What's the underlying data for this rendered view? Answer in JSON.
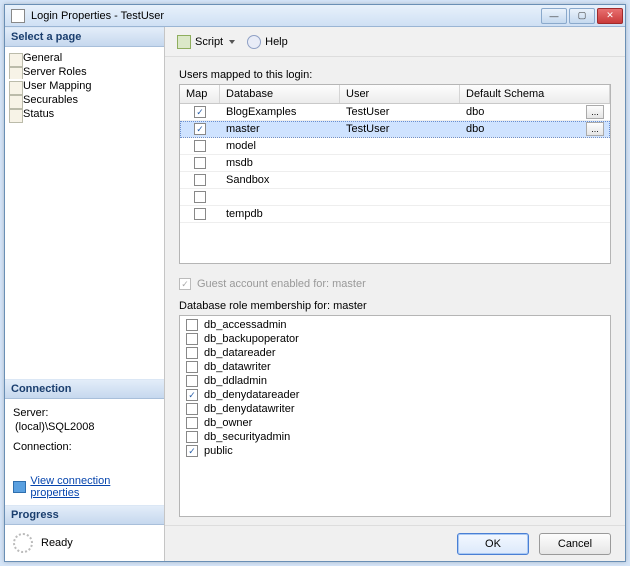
{
  "window": {
    "title": "Login Properties - TestUser"
  },
  "sidebar": {
    "select_page": "Select a page",
    "pages": [
      {
        "label": "General"
      },
      {
        "label": "Server Roles"
      },
      {
        "label": "User Mapping"
      },
      {
        "label": "Securables"
      },
      {
        "label": "Status"
      }
    ],
    "connection_head": "Connection",
    "server_label": "Server:",
    "server_value": "(local)\\SQL2008",
    "connection_label": "Connection:",
    "view_props": "View connection properties",
    "progress_head": "Progress",
    "progress_status": "Ready"
  },
  "toolbar": {
    "script": "Script",
    "help": "Help"
  },
  "main": {
    "users_mapped_label": "Users mapped to this login:",
    "columns": {
      "map": "Map",
      "database": "Database",
      "user": "User",
      "schema": "Default Schema"
    },
    "rows": [
      {
        "checked": true,
        "db": "BlogExamples",
        "user": "TestUser",
        "schema": "dbo",
        "ellipsis": true
      },
      {
        "checked": true,
        "db": "master",
        "user": "TestUser",
        "schema": "dbo",
        "selected": true,
        "ellipsis": true
      },
      {
        "checked": false,
        "db": "model",
        "user": "",
        "schema": ""
      },
      {
        "checked": false,
        "db": "msdb",
        "user": "",
        "schema": ""
      },
      {
        "checked": false,
        "db": "Sandbox",
        "user": "",
        "schema": ""
      },
      {
        "checked": false,
        "db": "",
        "user": "",
        "schema": ""
      },
      {
        "checked": false,
        "db": "tempdb",
        "user": "",
        "schema": ""
      }
    ],
    "guest_label": "Guest account enabled for: master",
    "roles_label": "Database role membership for: master",
    "roles": [
      {
        "name": "db_accessadmin",
        "checked": false
      },
      {
        "name": "db_backupoperator",
        "checked": false
      },
      {
        "name": "db_datareader",
        "checked": false
      },
      {
        "name": "db_datawriter",
        "checked": false
      },
      {
        "name": "db_ddladmin",
        "checked": false
      },
      {
        "name": "db_denydatareader",
        "checked": true
      },
      {
        "name": "db_denydatawriter",
        "checked": false
      },
      {
        "name": "db_owner",
        "checked": false
      },
      {
        "name": "db_securityadmin",
        "checked": false
      },
      {
        "name": "public",
        "checked": true
      }
    ]
  },
  "footer": {
    "ok": "OK",
    "cancel": "Cancel"
  }
}
